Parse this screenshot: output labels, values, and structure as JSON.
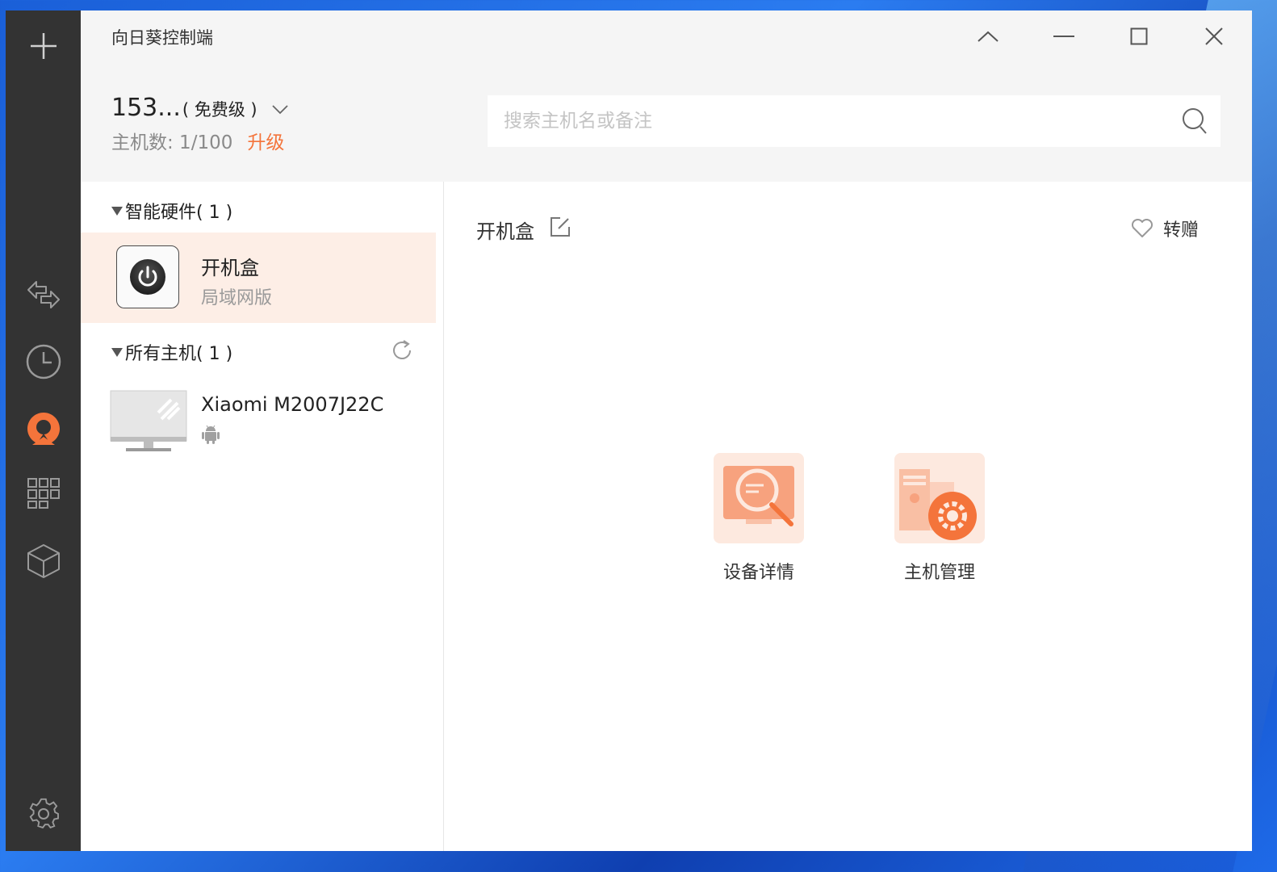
{
  "app": {
    "title": "向日葵控制端"
  },
  "account": {
    "id": "153...",
    "level": "( 免费级 )",
    "host_count_label": "主机数: 1/100",
    "upgrade_label": "升级"
  },
  "search": {
    "placeholder": "搜索主机名或备注"
  },
  "groups": {
    "smart_hardware": "智能硬件( 1 )",
    "all_hosts": "所有主机( 1 )"
  },
  "devices": [
    {
      "name": "开机盒",
      "subtitle": "局域网版"
    }
  ],
  "hosts": [
    {
      "name": "Xiaomi M2007J22C",
      "os_icon": "android-icon"
    }
  ],
  "detail": {
    "title": "开机盒",
    "gift_label": "转赠",
    "actions": [
      {
        "label": "设备详情",
        "icon": "device-details-icon"
      },
      {
        "label": "主机管理",
        "icon": "host-management-icon"
      }
    ]
  },
  "colors": {
    "accent": "#f4743b",
    "nav_bg": "#333333",
    "selected_bg": "#fdeee6"
  },
  "nav_icons": [
    "add-icon",
    "transfer-icon",
    "history-icon",
    "remote-control-icon",
    "apps-grid-icon",
    "cube-icon",
    "settings-icon"
  ]
}
